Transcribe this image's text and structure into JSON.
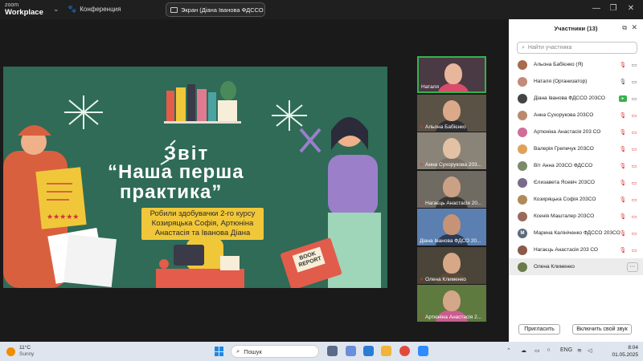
{
  "titlebar": {
    "logo_line1": "zoom",
    "logo_line2": "Workplace",
    "conference_label": "Конференция",
    "share_pill_label": "Экран (Діана Іванова ФДССО 2",
    "share_pill_more": "⋯"
  },
  "slide": {
    "title_line1": "Звіт",
    "title_line2": "“Наша перша",
    "title_line3": "практика”",
    "subtitle": "Робили здобувачки 2-го курсу Козиряцька Софія, Артюніна Анастасія та Іванова Діана",
    "book_report": "BOOK REPORT"
  },
  "video_tiles": [
    {
      "name": "Наталя",
      "muted": false,
      "active": true,
      "bg": "#4a3a44",
      "face": "#e8b69a",
      "body": "#d94c6a"
    },
    {
      "name": "Альона Бабієнко",
      "muted": true,
      "active": false,
      "bg": "#5b5246",
      "face": "#d9a98a",
      "body": "#2f2f33"
    },
    {
      "name": "Анна Сухорукова 203...",
      "muted": true,
      "active": false,
      "bg": "#8a8478",
      "face": "#e2c1a5",
      "body": "#7a7066"
    },
    {
      "name": "Нагаєць Анастасія 20...",
      "muted": true,
      "active": false,
      "bg": "#6f6a62",
      "face": "#caa185",
      "body": "#3a3634"
    },
    {
      "name": "Діана Іванова ФДСО 20...",
      "muted": false,
      "active": false,
      "bg": "#5a7fb0",
      "face": "#c79376",
      "body": "#2c3b55"
    },
    {
      "name": "Олена Клименко",
      "muted": true,
      "active": false,
      "bg": "#4b4438",
      "face": "#d6a888",
      "body": "#5b4a3a"
    },
    {
      "name": "Артюніна Анастасія 2...",
      "muted": true,
      "active": false,
      "bg": "#5f7a3f",
      "face": "#d4a68a",
      "body": "#c95c8f"
    }
  ],
  "panel": {
    "title": "Участники (13)",
    "search_placeholder": "Найти участника",
    "participants": [
      {
        "name": "Альона Бабієнко (Я)",
        "avatar_color": "#a86b4c",
        "initial": "",
        "mic": "muted",
        "cam": "on",
        "highlight": false
      },
      {
        "name": "Наталя (Организатор)",
        "avatar_color": "#c48a7a",
        "initial": "",
        "mic": "on",
        "cam": "on",
        "highlight": false
      },
      {
        "name": "Діана Іванова ФДССО 203СО",
        "avatar_color": "#444444",
        "initial": "",
        "mic": "share",
        "cam": "on",
        "highlight": false
      },
      {
        "name": "Анна Сухорукова 203СО",
        "avatar_color": "#b98a70",
        "initial": "",
        "mic": "muted",
        "cam": "muted",
        "highlight": false
      },
      {
        "name": "Артюніна Анастасія 203 СО",
        "avatar_color": "#d06d9a",
        "initial": "",
        "mic": "muted",
        "cam": "muted",
        "highlight": false
      },
      {
        "name": "Валерія Грепечук 203СО",
        "avatar_color": "#e0a15a",
        "initial": "",
        "mic": "muted",
        "cam": "muted",
        "highlight": false
      },
      {
        "name": "Віт Анна 203СО ФДССО",
        "avatar_color": "#7a8a6a",
        "initial": "",
        "mic": "muted",
        "cam": "muted",
        "highlight": false
      },
      {
        "name": "Єлизавета Ясевіч 203СО",
        "avatar_color": "#7a6a8a",
        "initial": "",
        "mic": "muted",
        "cam": "muted",
        "highlight": false
      },
      {
        "name": "Козиряцька Софія 203СО",
        "avatar_color": "#b08a5a",
        "initial": "",
        "mic": "muted",
        "cam": "muted",
        "highlight": false
      },
      {
        "name": "Ксенія Машталер 203СО",
        "avatar_color": "#9a6a5a",
        "initial": "",
        "mic": "muted",
        "cam": "muted",
        "highlight": false
      },
      {
        "name": "Марина Калініченко ФДССО 203СО",
        "avatar_color": "#5a6a7a",
        "initial": "М",
        "mic": "muted",
        "cam": "muted",
        "highlight": false
      },
      {
        "name": "Нагаєць Анастасія 203 СО",
        "avatar_color": "#8a5a4a",
        "initial": "",
        "mic": "muted",
        "cam": "muted",
        "highlight": false
      },
      {
        "name": "Олена Клименко",
        "avatar_color": "#6a7a4a",
        "initial": "",
        "mic": "",
        "cam": "",
        "highlight": true
      }
    ],
    "invite_label": "Пригласить",
    "unmute_label": "Включить свой звук"
  },
  "taskbar": {
    "temp": "11°C",
    "weather": "Sunny",
    "search_label": "Пошук",
    "lang": "ENG",
    "time": "8:04",
    "date": "01.05.2025"
  },
  "colors": {
    "slide_bg": "#2f6b57",
    "accent_yellow": "#f1c73a",
    "mute_red": "#e03131",
    "active_green": "#37b24d"
  }
}
